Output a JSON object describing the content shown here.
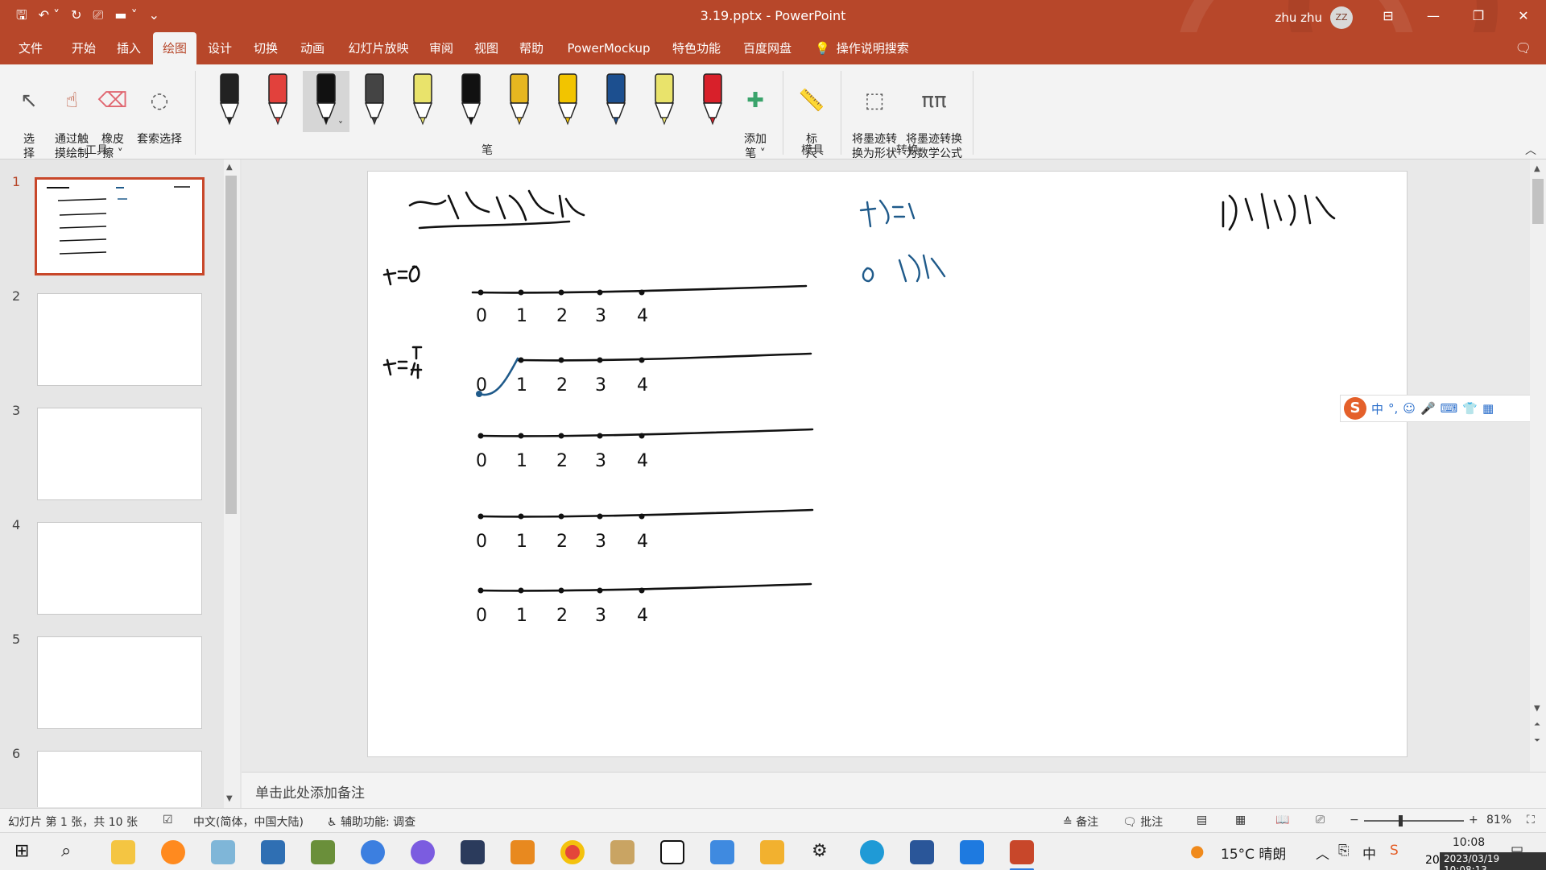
{
  "window": {
    "title": "3.19.pptx  -  PowerPoint",
    "user_name": "zhu zhu",
    "avatar_initials": "ZZ"
  },
  "menu": {
    "tabs": [
      "文件",
      "开始",
      "插入",
      "绘图",
      "设计",
      "切换",
      "动画",
      "幻灯片放映",
      "审阅",
      "视图",
      "帮助",
      "PowerMockup",
      "特色功能",
      "百度网盘"
    ],
    "active_tab": "绘图",
    "tell_me": "操作说明搜索"
  },
  "ribbon": {
    "tools": {
      "select": "选\n择",
      "touch_draw": "通过触\n摸绘制",
      "eraser": "橡皮\n擦 ˅",
      "lasso": "套索选择",
      "group_label": "工具"
    },
    "pens": {
      "group_label": "笔",
      "add_pen": "添加\n笔 ˅",
      "colors": [
        "#222222",
        "#e2413c",
        "#111111",
        "#444444",
        "#e9e36b",
        "#111111",
        "#e6b620",
        "#f2c400",
        "#1c4f8f",
        "#e9e36b",
        "#d8202a"
      ]
    },
    "stencils": {
      "ruler": "标\n尺",
      "group_label": "模具"
    },
    "convert": {
      "ink_to_shape": "将墨迹转\n换为形状",
      "ink_to_math": "将墨迹转换\n为数学公式",
      "group_label": "转换"
    }
  },
  "thumbnails": {
    "numbers": [
      "1",
      "2",
      "3",
      "4",
      "5",
      "6"
    ],
    "active": 0
  },
  "slide": {
    "ink_color_black": "#111111",
    "ink_color_blue": "#1f5a8a"
  },
  "ime_bar": {
    "logo": "S",
    "items": [
      "中",
      "°,",
      "☺",
      "🎤",
      "⌨",
      "👕",
      "▦"
    ]
  },
  "notes": {
    "placeholder": "单击此处添加备注"
  },
  "status": {
    "slide_info": "幻灯片 第 1 张，共 10 张",
    "language": "中文(简体，中国大陆)",
    "accessibility": "辅助功能: 调查",
    "notes_btn": "备注",
    "comments_btn": "批注",
    "zoom": "81%"
  },
  "taskbar": {
    "weather": "15°C  晴朗",
    "time": "10:08",
    "date_stamp": "2023/03/19 10:08:13",
    "year_prefix": "20"
  }
}
